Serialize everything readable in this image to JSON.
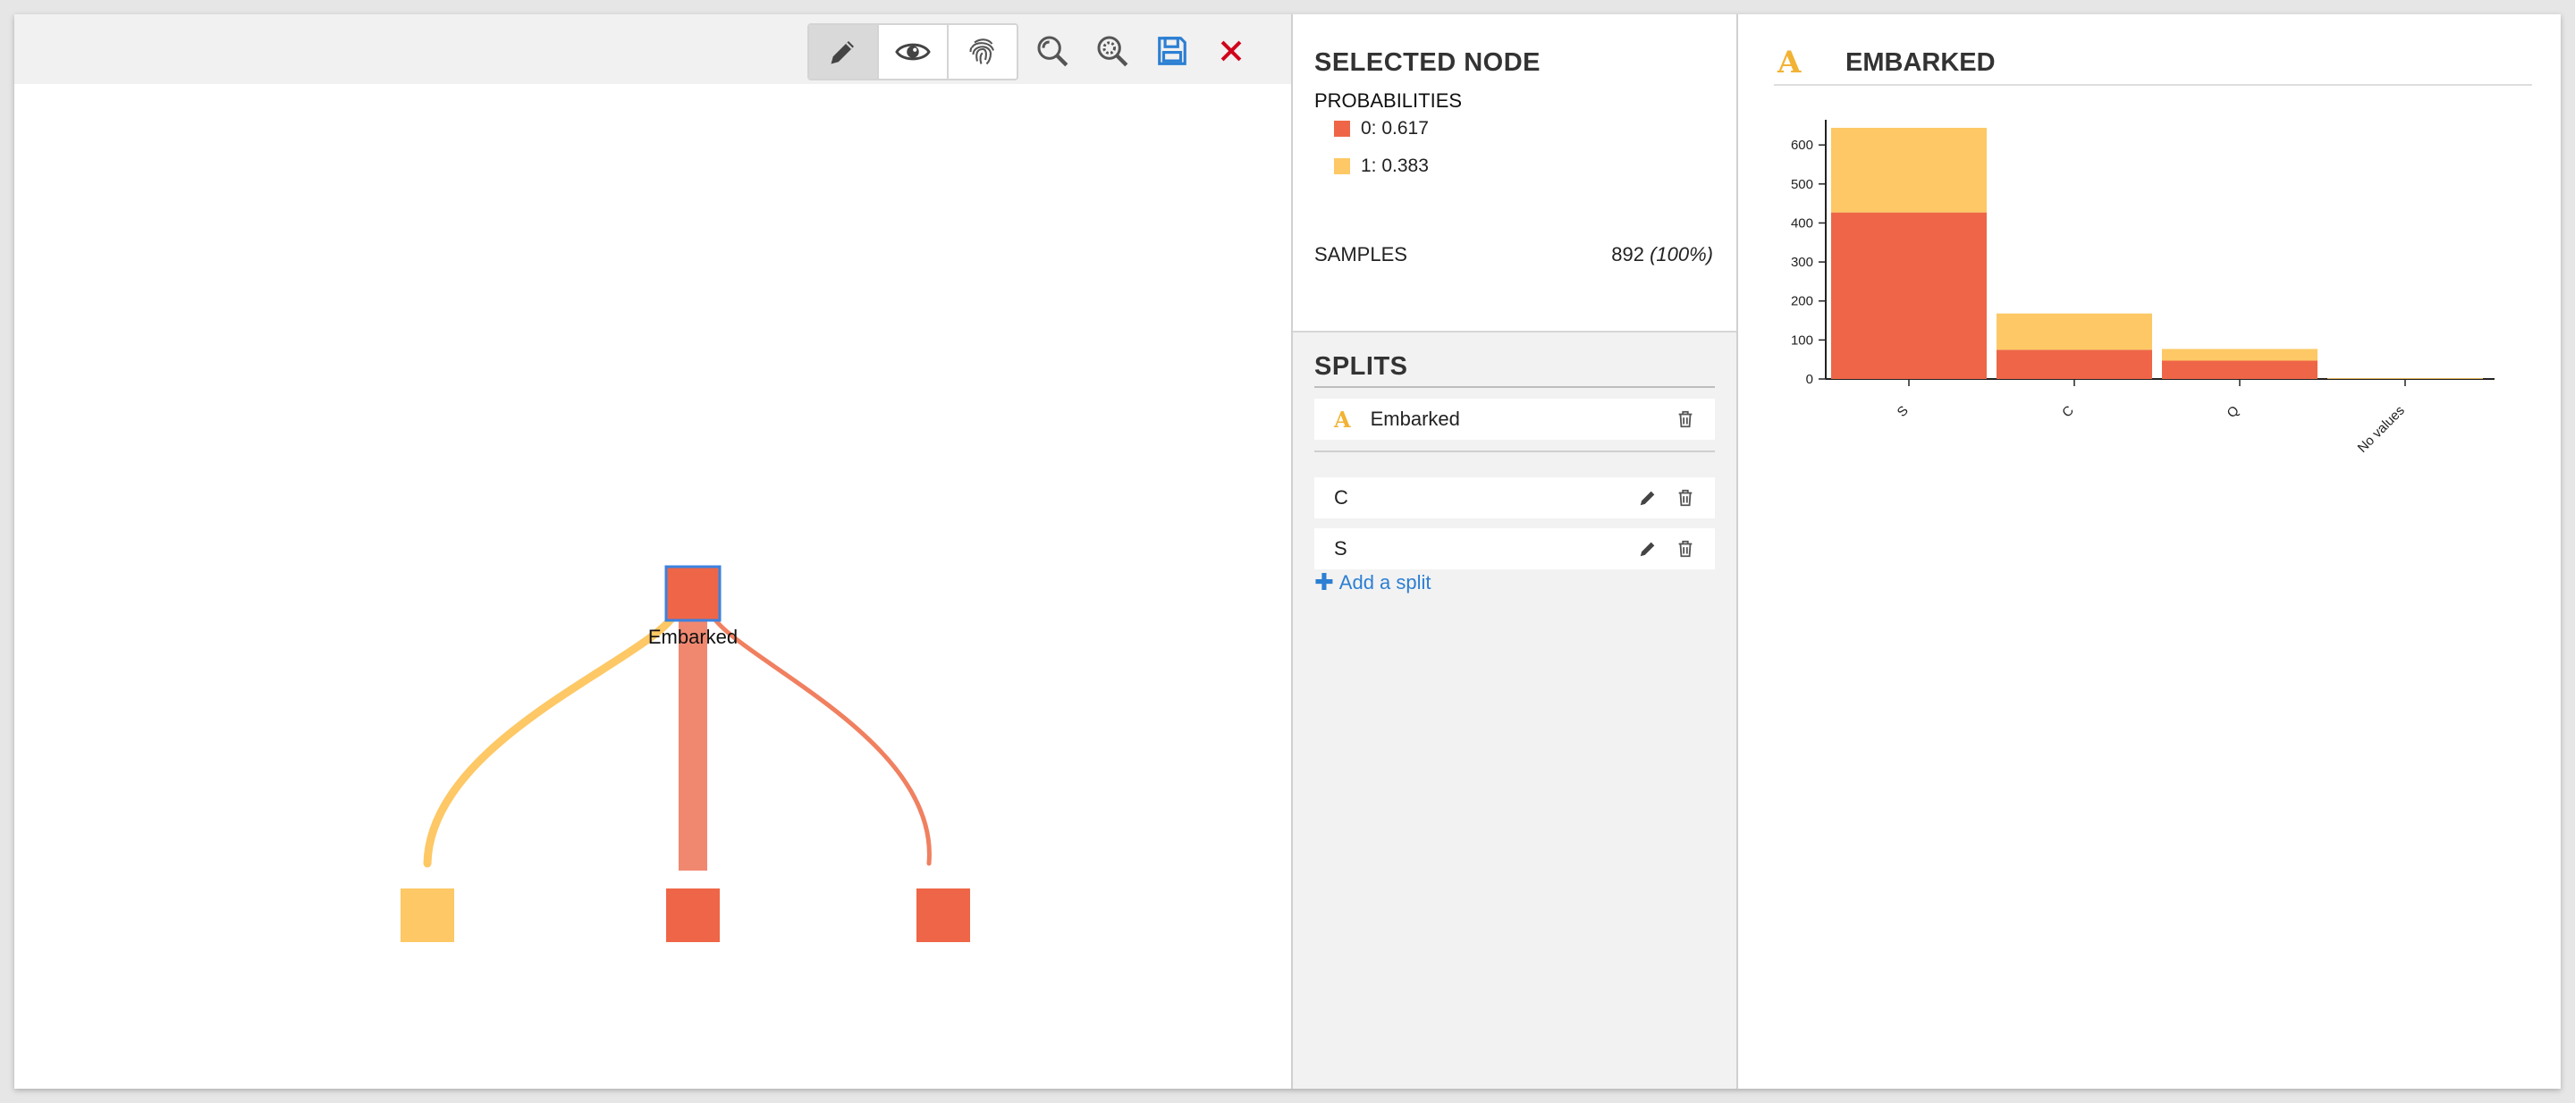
{
  "toolbar": {
    "modes": [
      {
        "name": "edit",
        "icon": "pencil-icon",
        "active": true
      },
      {
        "name": "view",
        "icon": "eye-icon",
        "active": false
      },
      {
        "name": "fingerprint",
        "icon": "fingerprint-icon",
        "active": false
      }
    ],
    "tools": [
      {
        "icon": "zoom-in-icon"
      },
      {
        "icon": "zoom-fit-icon"
      },
      {
        "icon": "save-icon",
        "color": "#2c7fd3"
      },
      {
        "icon": "close-icon",
        "color": "#d0021b"
      }
    ]
  },
  "tree": {
    "root_label": "Embarked",
    "colors": {
      "class0": "#ee6647",
      "class1": "#fdc865",
      "selected_border": "#3b82e0"
    }
  },
  "selected_node": {
    "title": "SELECTED NODE",
    "probabilities_heading": "PROBABILITIES",
    "probabilities": [
      {
        "label": "0: 0.617",
        "color": "#ee6647"
      },
      {
        "label": "1: 0.383",
        "color": "#fdc865"
      }
    ],
    "samples_label": "SAMPLES",
    "samples_value": "892",
    "samples_pct": "(100%)"
  },
  "splits": {
    "title": "SPLITS",
    "feature": "Embarked",
    "items": [
      {
        "label": "C"
      },
      {
        "label": "S"
      }
    ],
    "add_label": "Add a split"
  },
  "feature_panel": {
    "title": "EMBARKED",
    "icon": "categorical-a-icon"
  },
  "chart_data": {
    "type": "bar",
    "stacked": true,
    "categories": [
      "S",
      "C",
      "Q",
      "No values"
    ],
    "series": [
      {
        "name": "0",
        "color": "#ee6647",
        "values": [
          427,
          75,
          47,
          0
        ]
      },
      {
        "name": "1",
        "color": "#fdc865",
        "values": [
          217,
          93,
          30,
          2
        ]
      }
    ],
    "yticks": [
      0,
      100,
      200,
      300,
      400,
      500,
      600
    ],
    "ylim": [
      0,
      660
    ],
    "title": "",
    "xlabel": "",
    "ylabel": ""
  }
}
